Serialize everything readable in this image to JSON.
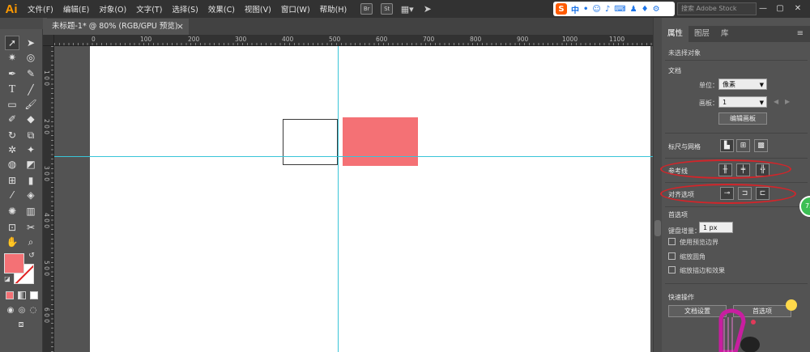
{
  "app": {
    "logo": "Ai"
  },
  "menu": [
    "文件(F)",
    "编辑(E)",
    "对象(O)",
    "文字(T)",
    "选择(S)",
    "效果(C)",
    "视图(V)",
    "窗口(W)",
    "帮助(H)"
  ],
  "menubar_icons": [
    {
      "name": "bridge-icon",
      "label": "Br"
    },
    {
      "name": "stock-icon",
      "label": "St"
    }
  ],
  "ime": {
    "label": "中"
  },
  "stock_search": {
    "placeholder": "搜索 Adobe Stock"
  },
  "document_tab": {
    "title": "未标题-1* @ 80% (RGB/GPU 预览)",
    "close": "×"
  },
  "ruler": {
    "h_ticks": [
      "0",
      "100",
      "200",
      "300",
      "400",
      "500",
      "600",
      "700",
      "800",
      "900",
      "1000",
      "1100"
    ],
    "v_ticks": [
      "1 0 0",
      "2 0 0",
      "3 0 0",
      "4 0 0",
      "5 0 0",
      "6 0 0"
    ]
  },
  "colors": {
    "fill": "#f47175",
    "guide": "#39c5d8",
    "annotation": "#d2252a"
  },
  "panel": {
    "tabs": [
      "属性",
      "图层",
      "库"
    ],
    "active_tab": "属性",
    "selection_status": "未选择对象",
    "document": {
      "heading": "文档",
      "unit_label": "单位：",
      "unit_value": "像素",
      "artboard_label": "画板：",
      "artboard_value": "1",
      "edit_artboard_button": "编辑画板"
    },
    "rulers_grids": {
      "heading": "标尺与网格"
    },
    "guides": {
      "heading": "参考线"
    },
    "snap": {
      "heading": "对齐选项"
    },
    "preferences": {
      "heading": "首选项",
      "keyboard_increment_label": "键盘增量：",
      "keyboard_increment_value": "1 px",
      "checkboxes": [
        "使用预览边界",
        "缩放圆角",
        "缩放描边和效果"
      ]
    },
    "quick_actions": {
      "heading": "快速操作",
      "document_setup_button": "文档设置",
      "preferences_button": "首选项"
    }
  },
  "badge": {
    "text": "73"
  }
}
